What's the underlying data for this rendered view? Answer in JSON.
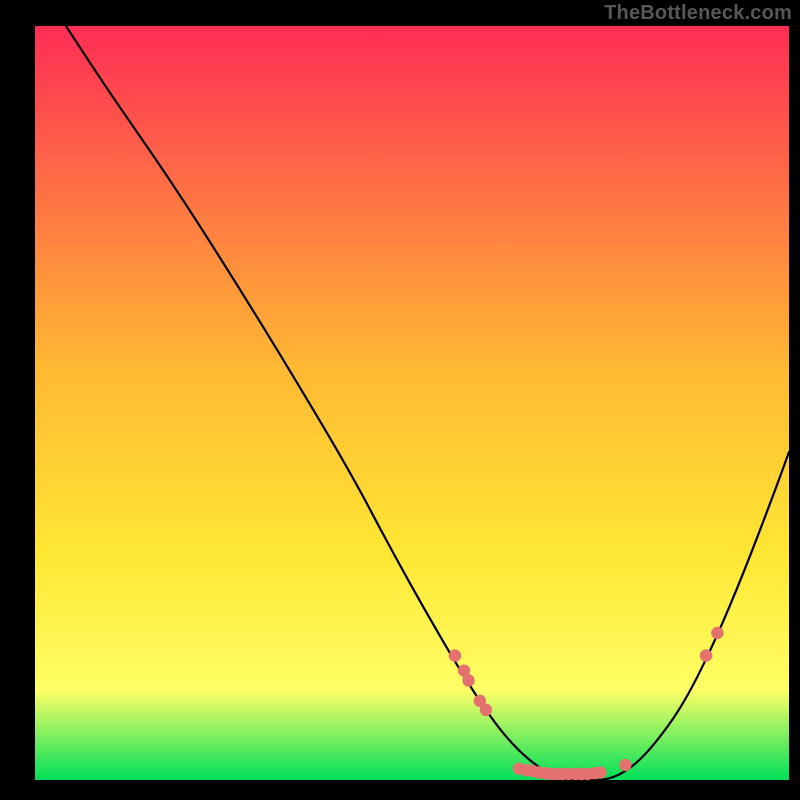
{
  "watermark": "TheBottleneck.com",
  "plot": {
    "x0": 35,
    "y0": 26,
    "x1": 789,
    "y1": 780,
    "gradient": {
      "top": "#ff2d55",
      "mid1": "#ffb833",
      "mid2": "#ffe733",
      "low": "#ffff66",
      "green": "#00e05a"
    }
  },
  "chart_data": {
    "type": "line",
    "title": "",
    "xlabel": "",
    "ylabel": "",
    "xlim": [
      0,
      100
    ],
    "ylim": [
      0,
      100
    ],
    "curve_x": [
      4.1,
      10,
      18,
      26,
      34,
      42,
      47,
      52,
      57,
      61,
      64,
      67,
      70,
      73,
      76,
      79,
      82,
      86,
      90,
      94,
      98,
      100
    ],
    "curve_y": [
      100,
      91,
      79.5,
      67,
      54,
      40.5,
      31,
      22,
      13.5,
      7.5,
      4,
      1.5,
      0,
      0,
      0,
      1.5,
      4.5,
      10,
      18,
      27.5,
      38,
      43.5
    ],
    "markers": [
      {
        "x": 55.7,
        "y": 16.5
      },
      {
        "x": 56.9,
        "y": 14.5
      },
      {
        "x": 57.5,
        "y": 13.2
      },
      {
        "x": 59.0,
        "y": 10.5
      },
      {
        "x": 59.8,
        "y": 9.3
      },
      {
        "x": 64.2,
        "y": 1.5
      },
      {
        "x": 65.2,
        "y": 1.3
      },
      {
        "x": 66.0,
        "y": 1.2
      },
      {
        "x": 66.8,
        "y": 1.0
      },
      {
        "x": 67.7,
        "y": 0.9
      },
      {
        "x": 68.5,
        "y": 0.8
      },
      {
        "x": 69.3,
        "y": 0.8
      },
      {
        "x": 70.0,
        "y": 0.8
      },
      {
        "x": 70.8,
        "y": 0.8
      },
      {
        "x": 71.7,
        "y": 0.8
      },
      {
        "x": 72.5,
        "y": 0.8
      },
      {
        "x": 73.3,
        "y": 0.8
      },
      {
        "x": 74.2,
        "y": 0.9
      },
      {
        "x": 75.0,
        "y": 1.0
      },
      {
        "x": 78.3,
        "y": 2.0
      },
      {
        "x": 89.0,
        "y": 16.5
      },
      {
        "x": 90.5,
        "y": 19.5
      }
    ]
  }
}
